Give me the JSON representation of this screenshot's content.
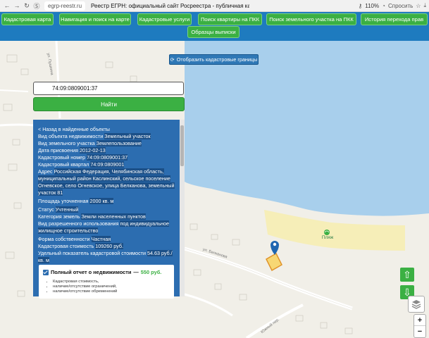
{
  "browser": {
    "url": "egrp-reestr.ru",
    "title": "Реестр ЕГРН: официальный сайт Росреестра - публичная кадастр...",
    "zoom": "110%",
    "ask": "Спросить"
  },
  "nav": {
    "items": [
      "Кадастровая карта",
      "Навигация и поиск на карте",
      "Кадастровые услуги",
      "Поиск квартиры на ПКК",
      "Поиск земельного участка на ПКК",
      "История перехода прав",
      "Образцы выписки"
    ]
  },
  "map": {
    "cadastral_button": "Отобразить кадастровые границы",
    "search_value": "74:09:0809001:37",
    "find_button": "Найти",
    "beach_label": "Пляж",
    "street_belkanova": "ул. Белканова",
    "street_yuzhny": "Южный пер.",
    "street_pushkina": "ул. Пушкина"
  },
  "panel": {
    "back": "< Назад в найденные объекты",
    "rows": [
      {
        "label": "Вид объекта недвижимости",
        "value": "Земельный участок"
      },
      {
        "label": "Вид земельного участка",
        "value": "Землепользование"
      },
      {
        "label": "Дата присвоения",
        "value": "2012-02-13"
      },
      {
        "label": "Кадастровый номер",
        "value": "74:09:0809001:37"
      },
      {
        "label": "Кадастровый квартал",
        "value": "74:09:0809001"
      },
      {
        "label": "Адрес",
        "value": "Российская Федерация, Челябинская область, муниципальный район Каслинский, сельское поселение Огневское, село Огневское, улица Белканова, земельный участок 81"
      },
      {
        "label": "Площадь уточненная",
        "value": "2000 кв. м"
      },
      {
        "label": "Статус",
        "value": "Учтенный"
      },
      {
        "label": "Категория земель",
        "value": "Земли населенных пунктов"
      },
      {
        "label": "Вид разрешенного использования",
        "value": "под индивидуальное жилищное строительство"
      },
      {
        "label": "Форма собственности",
        "value": "Частная"
      },
      {
        "label": "Кадастровая стоимость",
        "value": "109260 руб."
      },
      {
        "label": "Удельный показатель кадастровой стоимости",
        "value": "54.63 руб./кв. м"
      }
    ],
    "collapse_mark": "▲"
  },
  "report": {
    "title": "Полный отчет о недвижимости",
    "dash": " — ",
    "price": "550 руб.",
    "items": [
      "Кадастровая стоимость,",
      "наличие/отсутствие ограничений,",
      "наличие/отсутствие обременений"
    ]
  },
  "colors": {
    "nav_bg": "#1e7bbf",
    "nav_button": "#3bb043",
    "panel_bg": "#2c6db0",
    "water": "#a8cfec",
    "beach": "#f6eeb8"
  },
  "icons": {
    "refresh": "refresh-icon",
    "map_marker": "map-marker-icon",
    "beach": "beach-icon",
    "arrow_up": "arrow-up-icon",
    "arrow_down": "arrow-down-icon",
    "layers": "layers-icon"
  },
  "zoom_controls": {
    "plus": "+",
    "minus": "−"
  }
}
